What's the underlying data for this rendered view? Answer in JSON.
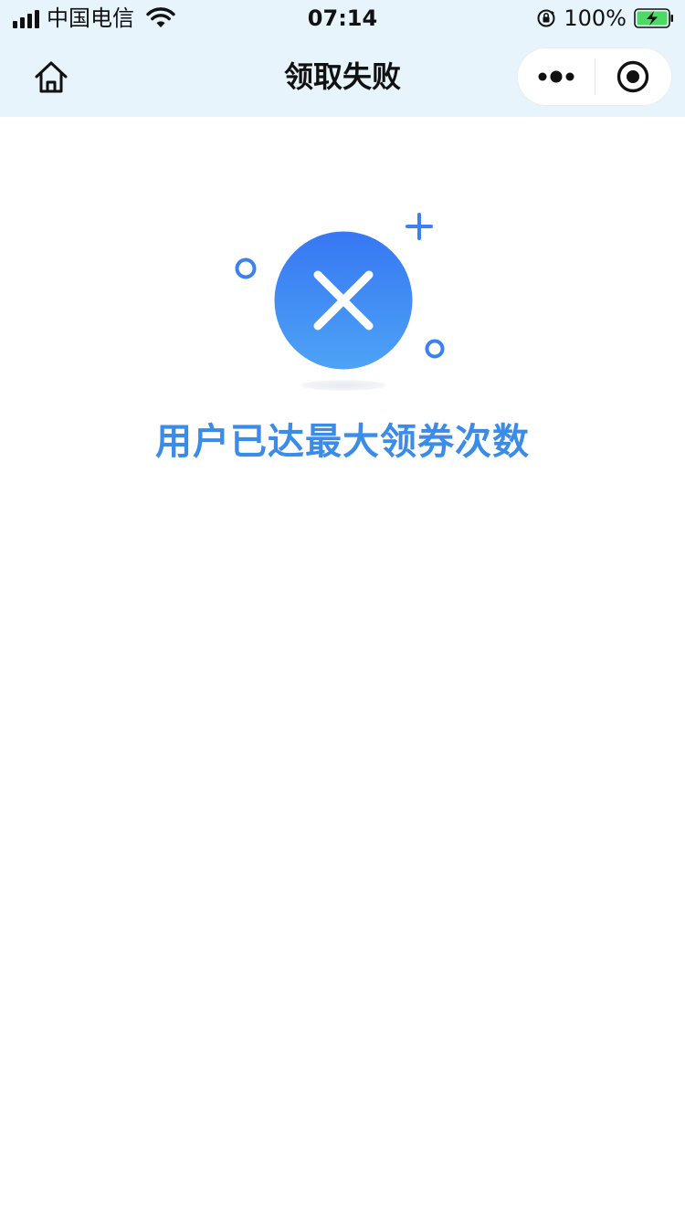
{
  "status_bar": {
    "carrier": "中国电信",
    "time": "07:14",
    "battery_percent": "100%",
    "icons": [
      "signal-icon",
      "wifi-icon",
      "orientation-lock-icon",
      "battery-charging-icon"
    ]
  },
  "nav": {
    "title": "领取失败",
    "home_icon": "home-icon",
    "more_icon": "more-dots-icon",
    "close_icon": "target-close-icon"
  },
  "main": {
    "status_icon": "error-x-icon",
    "message": "用户已达最大领券次数"
  },
  "colors": {
    "top_background": "#e8f4fb",
    "accent_blue": "#3b8be8",
    "circle_top": "#3777f3",
    "circle_bottom": "#4da3f6"
  }
}
